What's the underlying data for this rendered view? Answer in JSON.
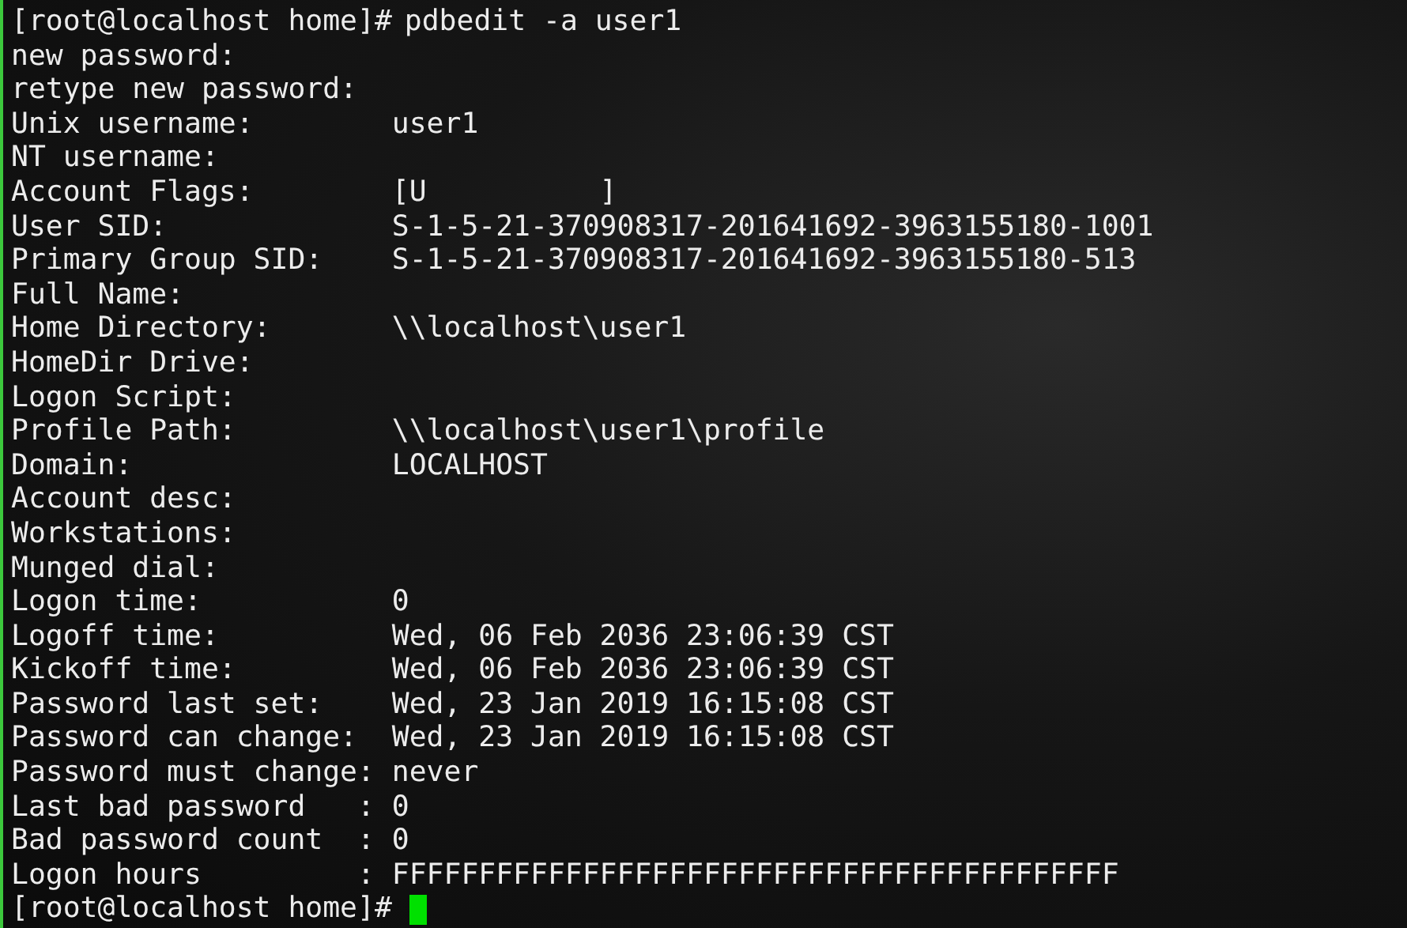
{
  "terminal": {
    "lines": [
      {
        "kind": "prompt",
        "prompt": "[root@localhost home]#",
        "command": "pdbedit -a user1"
      },
      {
        "kind": "field",
        "label": "new password:"
      },
      {
        "kind": "field",
        "label": "retype new password:"
      },
      {
        "kind": "field",
        "label": "Unix username:",
        "value": "user1"
      },
      {
        "kind": "field",
        "label": "NT username:"
      },
      {
        "kind": "field",
        "label": "Account Flags:",
        "value": "[U          ]"
      },
      {
        "kind": "field",
        "label": "User SID:",
        "value": "S-1-5-21-370908317-201641692-3963155180-1001"
      },
      {
        "kind": "field",
        "label": "Primary Group SID:",
        "value": "S-1-5-21-370908317-201641692-3963155180-513"
      },
      {
        "kind": "field",
        "label": "Full Name:"
      },
      {
        "kind": "field",
        "label": "Home Directory:",
        "value": "\\\\localhost\\user1"
      },
      {
        "kind": "field",
        "label": "HomeDir Drive:"
      },
      {
        "kind": "field",
        "label": "Logon Script:"
      },
      {
        "kind": "field",
        "label": "Profile Path:",
        "value": "\\\\localhost\\user1\\profile"
      },
      {
        "kind": "field",
        "label": "Domain:",
        "value": "LOCALHOST"
      },
      {
        "kind": "field",
        "label": "Account desc:"
      },
      {
        "kind": "field",
        "label": "Workstations:"
      },
      {
        "kind": "field",
        "label": "Munged dial:"
      },
      {
        "kind": "field",
        "label": "Logon time:",
        "value": "0"
      },
      {
        "kind": "field",
        "label": "Logoff time:",
        "value": "Wed, 06 Feb 2036 23:06:39 CST"
      },
      {
        "kind": "field",
        "label": "Kickoff time:",
        "value": "Wed, 06 Feb 2036 23:06:39 CST"
      },
      {
        "kind": "field",
        "label": "Password last set:",
        "value": "Wed, 23 Jan 2019 16:15:08 CST"
      },
      {
        "kind": "field",
        "label": "Password can change:",
        "value": "Wed, 23 Jan 2019 16:15:08 CST"
      },
      {
        "kind": "field",
        "label": "Password must change:",
        "value": "never"
      },
      {
        "kind": "field",
        "label": "Last bad password   :",
        "value": "0"
      },
      {
        "kind": "field",
        "label": "Bad password count  :",
        "value": "0"
      },
      {
        "kind": "field",
        "label": "Logon hours         :",
        "value": "FFFFFFFFFFFFFFFFFFFFFFFFFFFFFFFFFFFFFFFFFF"
      },
      {
        "kind": "prompt",
        "prompt": "[root@localhost home]#",
        "cursor": true
      }
    ]
  }
}
